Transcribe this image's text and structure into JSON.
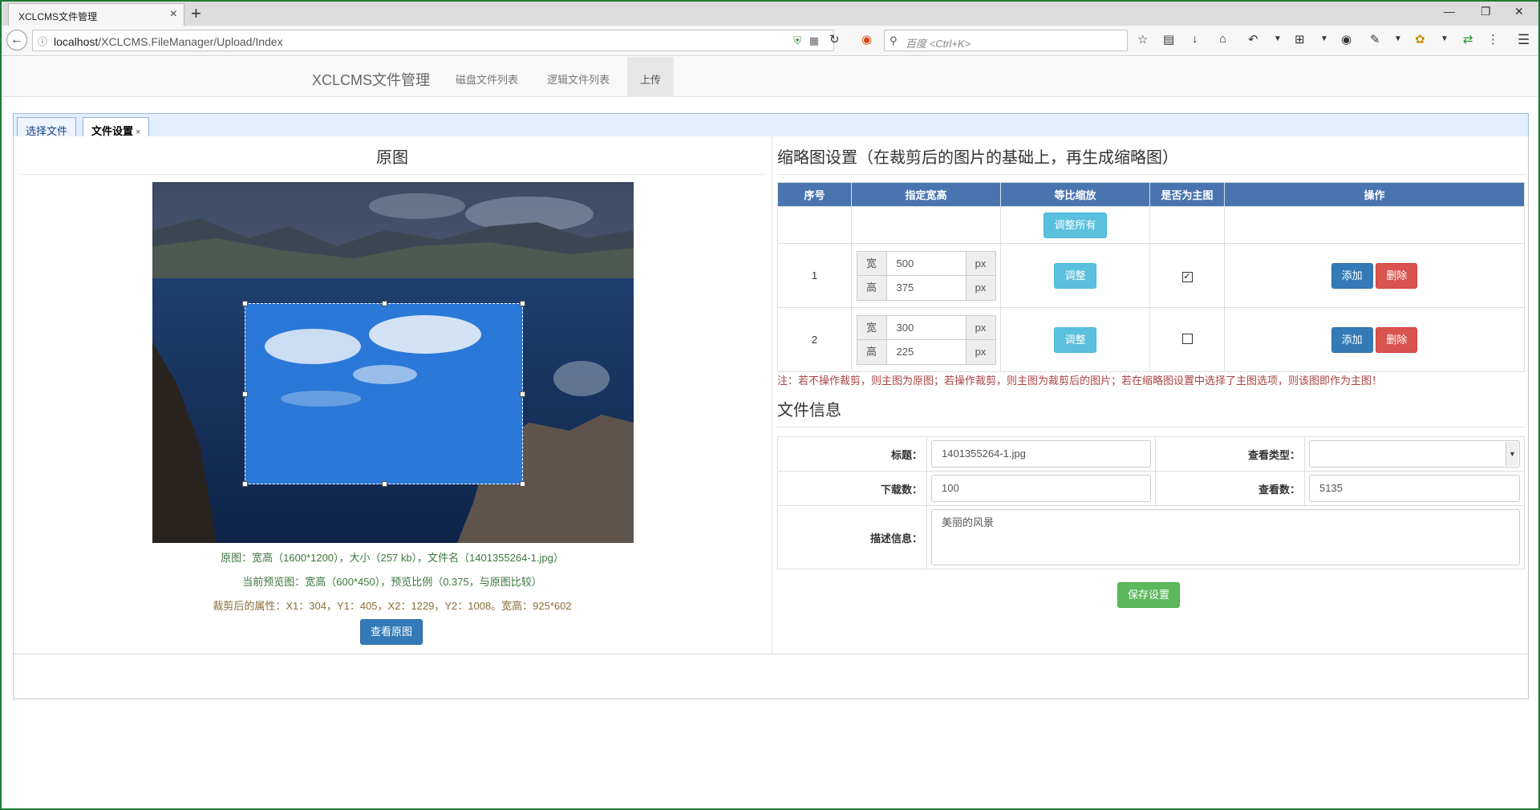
{
  "browser": {
    "tab_title": "XCLCMS文件管理",
    "new_tab": "+",
    "url_host": "localhost",
    "url_path": "/XCLCMS.FileManager/Upload/Index",
    "search_placeholder": "百度 <Ctrl+K>"
  },
  "site": {
    "brand": "XCLCMS文件管理",
    "nav": [
      "磁盘文件列表",
      "逻辑文件列表",
      "上传"
    ],
    "active_nav": "上传"
  },
  "panel_tabs": [
    {
      "label": "选择文件",
      "selected": false
    },
    {
      "label": "文件设置",
      "selected": true,
      "close": "×"
    }
  ],
  "original": {
    "title": "原图",
    "info1": "原图：宽高（1600*1200），大小（257 kb），文件名（1401355264-1.jpg）",
    "info2": "当前预览图：宽高（600*450），预览比例（0.375，与原图比较）",
    "info3": "裁剪后的属性：X1：304，Y1：405，X2：1229，Y2：1008。宽高：925*602",
    "view_button": "查看原图",
    "colors": {
      "info1": "#3c763d",
      "info2": "#3c763d",
      "info3": "#8a6d3b"
    }
  },
  "thumbnail": {
    "title": "缩略图设置（在裁剪后的图片的基础上，再生成缩略图）",
    "headers": [
      "序号",
      "指定宽高",
      "等比缩放",
      "是否为主图",
      "操作"
    ],
    "adjust_all": "调整所有",
    "width_label": "宽",
    "height_label": "高",
    "unit": "px",
    "adjust_label": "调整",
    "add_label": "添加",
    "delete_label": "删除",
    "rows": [
      {
        "no": "1",
        "width": "500",
        "height": "375",
        "main": true
      },
      {
        "no": "2",
        "width": "300",
        "height": "225",
        "main": false
      }
    ],
    "note": "注：若不操作裁剪，则主图为原图；若操作裁剪，则主图为裁剪后的图片；若在缩略图设置中选择了主图选项，则该图即作为主图！"
  },
  "file_info": {
    "title": "文件信息",
    "title_label": "标题：",
    "title_value": "1401355264-1.jpg",
    "view_type_label": "查看类型：",
    "view_type_value": "",
    "downloads_label": "下载数：",
    "downloads_value": "100",
    "views_label": "查看数：",
    "views_value": "5135",
    "desc_label": "描述信息：",
    "desc_value": "美丽的风景",
    "save_button": "保存设置"
  }
}
